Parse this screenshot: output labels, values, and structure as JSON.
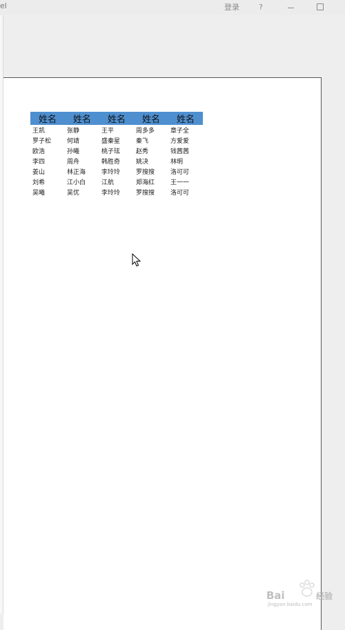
{
  "titlebar": {
    "app_title": "el",
    "login": "登录",
    "help": "?"
  },
  "table": {
    "headers": [
      "姓名",
      "姓名",
      "姓名",
      "姓名",
      "姓名"
    ],
    "rows": [
      [
        "王凯",
        "张静",
        "王平",
        "周多多",
        "章子全"
      ],
      [
        "罗子松",
        "何靖",
        "盛秦星",
        "秦飞",
        "方爱爱"
      ],
      [
        "欧浩",
        "孙曦",
        "桃子玹",
        "赵秀",
        "钱茜茜"
      ],
      [
        "李四",
        "周舟",
        "韩胜奇",
        "姚决",
        "林明"
      ],
      [
        "姜山",
        "林正海",
        "李玲玲",
        "罗搜搜",
        "洛可可"
      ],
      [
        "刘希",
        "江小白",
        "江航",
        "郑海红",
        "王一一"
      ],
      [
        "吴曦",
        "吴优",
        "李玲玲",
        "罗搜搜",
        "洛可可"
      ]
    ]
  },
  "watermark": {
    "logo": "Baidu经验",
    "url": "jingyan.baidu.com"
  }
}
